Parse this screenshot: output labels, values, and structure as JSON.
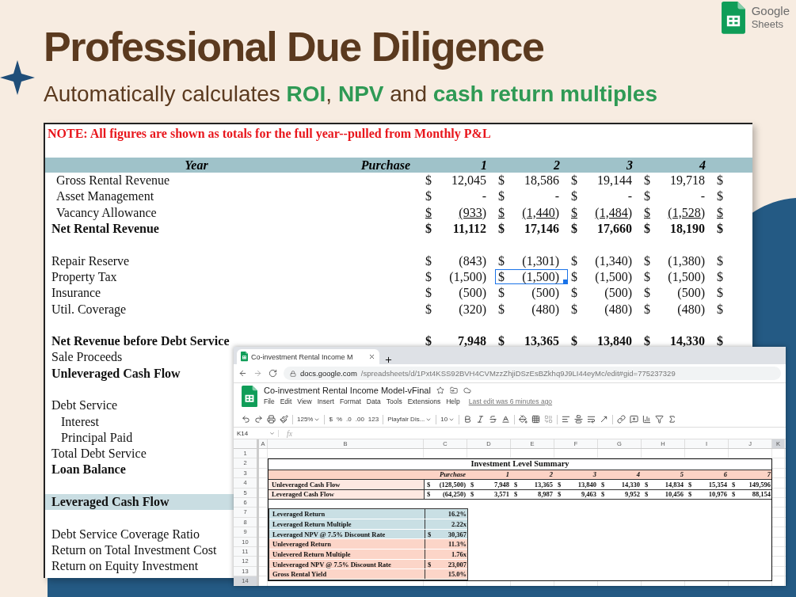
{
  "banner": {
    "title": "Professional Due Diligence",
    "subtitle": [
      {
        "text": "Automatically calculates ",
        "highlight": false
      },
      {
        "text": "ROI",
        "highlight": true
      },
      {
        "text": ", ",
        "highlight": false
      },
      {
        "text": "NPV",
        "highlight": true
      },
      {
        "text": " and ",
        "highlight": false
      },
      {
        "text": "cash return multiples",
        "highlight": true
      }
    ]
  },
  "brand": {
    "name": "Google",
    "product": "Sheets"
  },
  "pl_sheet": {
    "note": "NOTE: All figures are shown as totals for the full year--pulled from Monthly P&L",
    "header": {
      "year": "Year",
      "purchase": "Purchase",
      "years": [
        "1",
        "2",
        "3",
        "4"
      ]
    },
    "rows": [
      {
        "label": "Gross Rental Revenue",
        "kind": "line",
        "cells": [
          {
            "cur": "$",
            "v": "12,045",
            "selected": false
          },
          {
            "cur": "$",
            "v": "18,586",
            "selected": false
          },
          {
            "cur": "$",
            "v": "19,144",
            "selected": false
          },
          {
            "cur": "$",
            "v": "19,718",
            "selected": false
          },
          {
            "cur": "$",
            "selected": false
          }
        ]
      },
      {
        "label": "Asset Management",
        "kind": "line",
        "cells": [
          {
            "cur": "$",
            "v": "-",
            "selected": false
          },
          {
            "cur": "$",
            "v": "-",
            "selected": false
          },
          {
            "cur": "$",
            "v": "-",
            "selected": false
          },
          {
            "cur": "$",
            "v": "-",
            "selected": false
          },
          {
            "cur": "$",
            "selected": false
          }
        ]
      },
      {
        "label": "Vacancy Allowance",
        "kind": "underlined",
        "cells": [
          {
            "cur": "$",
            "v": "(933)",
            "selected": false
          },
          {
            "cur": "$",
            "v": "(1,440)",
            "selected": false
          },
          {
            "cur": "$",
            "v": "(1,484)",
            "selected": false
          },
          {
            "cur": "$",
            "v": "(1,528)",
            "selected": false
          },
          {
            "cur": "$",
            "selected": false
          }
        ]
      },
      {
        "label": "Net Rental Revenue",
        "kind": "total",
        "cells": [
          {
            "cur": "$",
            "v": "11,112",
            "selected": false
          },
          {
            "cur": "$",
            "v": "17,146",
            "selected": false
          },
          {
            "cur": "$",
            "v": "17,660",
            "selected": false
          },
          {
            "cur": "$",
            "v": "18,190",
            "selected": false
          },
          {
            "cur": "$",
            "selected": false
          }
        ]
      },
      {
        "kind": "blank"
      },
      {
        "label": "Repair Reserve",
        "kind": "plain",
        "cells": [
          {
            "cur": "$",
            "v": "(843)",
            "selected": false
          },
          {
            "cur": "$",
            "v": "(1,301)",
            "selected": false
          },
          {
            "cur": "$",
            "v": "(1,340)",
            "selected": false
          },
          {
            "cur": "$",
            "v": "(1,380)",
            "selected": false
          },
          {
            "cur": "$",
            "selected": false
          }
        ]
      },
      {
        "label": "Property Tax",
        "kind": "plain",
        "cells": [
          {
            "cur": "$",
            "v": "(1,500)",
            "selected": false
          },
          {
            "cur": "$",
            "v": "(1,500)",
            "selected": true
          },
          {
            "cur": "$",
            "v": "(1,500)",
            "selected": false
          },
          {
            "cur": "$",
            "v": "(1,500)",
            "selected": false
          },
          {
            "cur": "$",
            "selected": false
          }
        ]
      },
      {
        "label": "Insurance",
        "kind": "plain",
        "cells": [
          {
            "cur": "$",
            "v": "(500)",
            "selected": false
          },
          {
            "cur": "$",
            "v": "(500)",
            "selected": false
          },
          {
            "cur": "$",
            "v": "(500)",
            "selected": false
          },
          {
            "cur": "$",
            "v": "(500)",
            "selected": false
          },
          {
            "cur": "$",
            "selected": false
          }
        ]
      },
      {
        "label": "Util. Coverage",
        "kind": "plain",
        "cells": [
          {
            "cur": "$",
            "v": "(320)",
            "selected": false
          },
          {
            "cur": "$",
            "v": "(480)",
            "selected": false
          },
          {
            "cur": "$",
            "v": "(480)",
            "selected": false
          },
          {
            "cur": "$",
            "v": "(480)",
            "selected": false
          },
          {
            "cur": "$",
            "selected": false
          }
        ]
      },
      {
        "kind": "blank"
      },
      {
        "label": "Net Revenue before Debt Service",
        "kind": "total",
        "cells": [
          {
            "cur": "$",
            "v": "7,948",
            "selected": false
          },
          {
            "cur": "$",
            "v": "13,365",
            "selected": false
          },
          {
            "cur": "$",
            "v": "13,840",
            "selected": false
          },
          {
            "cur": "$",
            "v": "14,330",
            "selected": false
          },
          {
            "cur": "$",
            "selected": false
          }
        ]
      },
      {
        "label": "Sale Proceeds",
        "kind": "plain"
      },
      {
        "label": "Unleveraged Cash Flow",
        "kind": "total"
      },
      {
        "kind": "blank"
      },
      {
        "label": "Debt Service",
        "kind": "plain",
        "children": [
          {
            "label": "Interest",
            "kind": "plain"
          },
          {
            "label": "Principal Paid",
            "kind": "plain"
          }
        ]
      },
      {
        "label": "Total Debt Service",
        "kind": "plain"
      },
      {
        "label": "Loan Balance",
        "kind": "total"
      },
      {
        "kind": "blank"
      },
      {
        "label": "Leveraged Cash Flow",
        "kind": "highlight"
      },
      {
        "kind": "blank"
      },
      {
        "label": "Debt Service Coverage Ratio",
        "kind": "plain"
      },
      {
        "label": "Return on Total Investment Cost",
        "kind": "plain"
      },
      {
        "label": "Return on Equity Investment",
        "kind": "plain"
      }
    ]
  },
  "browser": {
    "tab": "Co-investment Rental Income M",
    "host": "docs.google.com",
    "path": "/spreadsheets/d/1Pxt4KSS92BVH4CVMzzZhjiDSzEsBZkhq9J9LI44eyMc/edit#gid=775237329"
  },
  "sheets_app": {
    "doc_title": "Co-investment Rental Income Model-vFinal",
    "menus": [
      "File",
      "Edit",
      "View",
      "Insert",
      "Format",
      "Data",
      "Tools",
      "Extensions",
      "Help"
    ],
    "last_edit": "Last edit was 6 minutes ago",
    "toolbar": {
      "zoom": "125%",
      "formats": [
        "$",
        "%",
        ".0",
        ".00",
        "123"
      ],
      "font": "Playfair Dis...",
      "size": "10"
    },
    "cell_ref": "K14",
    "fx": "fx",
    "columns": [
      {
        "label": "A",
        "selected": false
      },
      {
        "label": "B",
        "selected": false
      },
      {
        "label": "C",
        "selected": false
      },
      {
        "label": "D",
        "selected": false
      },
      {
        "label": "E",
        "selected": false
      },
      {
        "label": "F",
        "selected": false
      },
      {
        "label": "G",
        "selected": false
      },
      {
        "label": "H",
        "selected": false
      },
      {
        "label": "I",
        "selected": false
      },
      {
        "label": "J",
        "selected": false
      },
      {
        "label": "K",
        "selected": true
      }
    ],
    "rows": [
      {
        "label": "1",
        "selected": false
      },
      {
        "label": "2",
        "selected": false
      },
      {
        "label": "3",
        "selected": false
      },
      {
        "label": "4",
        "selected": false
      },
      {
        "label": "5",
        "selected": false
      },
      {
        "label": "6",
        "selected": false
      },
      {
        "label": "7",
        "selected": false
      },
      {
        "label": "8",
        "selected": false
      },
      {
        "label": "9",
        "selected": false
      },
      {
        "label": "10",
        "selected": false
      },
      {
        "label": "11",
        "selected": false
      },
      {
        "label": "12",
        "selected": false
      },
      {
        "label": "13",
        "selected": false
      },
      {
        "label": "14",
        "selected": true
      }
    ],
    "summary": {
      "title": "Investment Level Summary",
      "header": {
        "purchase": "Purchase",
        "years": [
          "1",
          "2",
          "3",
          "4",
          "5",
          "6",
          "7"
        ]
      },
      "flows": [
        {
          "label": "Unleveraged Cash Flow",
          "cells": [
            {
              "cur": "$",
              "v": "(128,500)"
            },
            {
              "cur": "$",
              "v": "7,948"
            },
            {
              "cur": "$",
              "v": "13,365"
            },
            {
              "cur": "$",
              "v": "13,840"
            },
            {
              "cur": "$",
              "v": "14,330"
            },
            {
              "cur": "$",
              "v": "14,834"
            },
            {
              "cur": "$",
              "v": "15,354"
            },
            {
              "cur": "$",
              "v": "149,596"
            }
          ]
        },
        {
          "label": "Leveraged Cash Flow",
          "cells": [
            {
              "cur": "$",
              "v": "(64,250)"
            },
            {
              "cur": "$",
              "v": "3,571"
            },
            {
              "cur": "$",
              "v": "8,987"
            },
            {
              "cur": "$",
              "v": "9,463"
            },
            {
              "cur": "$",
              "v": "9,952"
            },
            {
              "cur": "$",
              "v": "10,456"
            },
            {
              "cur": "$",
              "v": "10,976"
            },
            {
              "cur": "$",
              "v": "88,154"
            }
          ]
        }
      ],
      "metrics": [
        {
          "label": "Leveraged Return",
          "value": "16.2%",
          "kind": "leveraged"
        },
        {
          "label": "Leveraged Return Multiple",
          "value": "2.22x",
          "kind": "leveraged"
        },
        {
          "label": "Leveraged NPV @ 7.5% Discount Rate",
          "cur": "$",
          "value": "30,367",
          "kind": "leveraged"
        },
        {
          "label": "Unleveraged Return",
          "value": "11.3%",
          "kind": "unleveraged"
        },
        {
          "label": "Unlevered Return Multiple",
          "value": "1.76x",
          "kind": "unleveraged"
        },
        {
          "label": "Unleveraged NPV @ 7.5% Discount Rate",
          "cur": "$",
          "value": "23,007",
          "kind": "unleveraged"
        },
        {
          "label": "Gross Rental Yield",
          "value": "15.0%",
          "kind": "unleveraged"
        }
      ]
    }
  }
}
